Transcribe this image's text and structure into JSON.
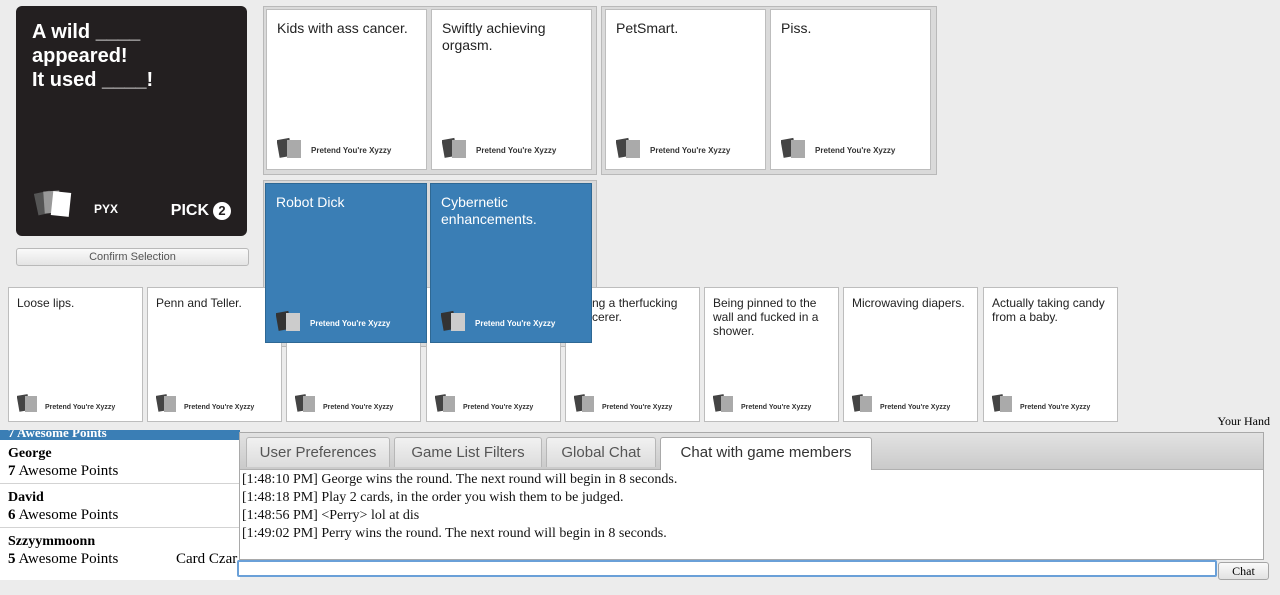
{
  "black_card": {
    "line1": "A wild ____ appeared!",
    "line2": "It used ____!",
    "logo_text": "PYX",
    "pick_label": "PICK",
    "pick_count": "2"
  },
  "confirm_label": "Confirm Selection",
  "played_groups": [
    [
      {
        "text": "Kids with ass cancer.",
        "brand": "Pretend You're Xyzzy"
      },
      {
        "text": "Swiftly achieving orgasm.",
        "brand": "Pretend You're Xyzzy"
      }
    ],
    [
      {
        "text": "PetSmart.",
        "brand": "Pretend You're Xyzzy"
      },
      {
        "text": "Piss.",
        "brand": "Pretend You're Xyzzy"
      }
    ],
    [
      {
        "text": "Robot Dick",
        "brand": "Pretend You're Xyzzy"
      },
      {
        "text": "Cybernetic enhancements.",
        "brand": "Pretend You're Xyzzy"
      }
    ]
  ],
  "hand_label": "Your Hand",
  "hand": [
    {
      "text": "Loose lips.",
      "brand": "Pretend You're Xyzzy"
    },
    {
      "text": "Penn and Teller.",
      "brand": "Pretend You're Xyzzy"
    },
    {
      "text": "",
      "brand": "Pretend You're Xyzzy"
    },
    {
      "text": "ng a therfucking cerer.",
      "brand": "Pretend You're Xyzzy"
    },
    {
      "text": "Being pinned to the wall and fucked in a shower.",
      "brand": "Pretend You're Xyzzy"
    },
    {
      "text": "Microwaving diapers.",
      "brand": "Pretend You're Xyzzy"
    },
    {
      "text": "Actually taking candy from a baby.",
      "brand": "Pretend You're Xyzzy"
    }
  ],
  "scoreboard": {
    "header": "7 Awesome Points",
    "players": [
      {
        "name": "George",
        "points": "7",
        "points_label": "Awesome Points",
        "status": ""
      },
      {
        "name": "David",
        "points": "6",
        "points_label": "Awesome Points",
        "status": ""
      },
      {
        "name": "Szzyymmoonn",
        "points": "5",
        "points_label": "Awesome Points",
        "status": "Card Czar"
      }
    ]
  },
  "tabs": [
    {
      "label": "User Preferences",
      "active": false
    },
    {
      "label": "Game List Filters",
      "active": false
    },
    {
      "label": "Global Chat",
      "active": false
    },
    {
      "label": "Chat with game members",
      "active": true
    }
  ],
  "chat_log": [
    "[1:48:10 PM] George wins the round. The next round will begin in 8 seconds.",
    "[1:48:18 PM] Play 2 cards, in the order you wish them to be judged.",
    "[1:48:56 PM] <Perry> lol at dis",
    "[1:49:02 PM] Perry wins the round. The next round will begin in 8 seconds."
  ],
  "chat_input_value": "",
  "chat_button_label": "Chat",
  "colors": {
    "black_card": "#231f20",
    "selected_card": "#3a7eb5",
    "background": "#ececec"
  }
}
